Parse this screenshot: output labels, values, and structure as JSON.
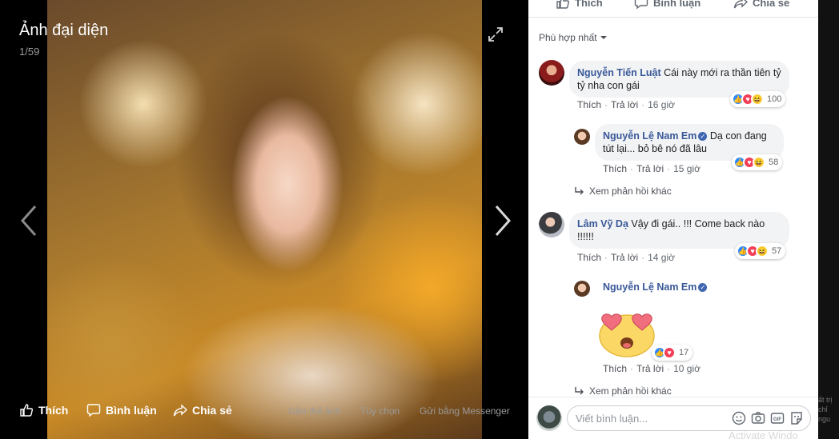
{
  "viewer": {
    "title": "Ảnh đại diện",
    "counter": "1/59",
    "actions": {
      "like": "Thích",
      "comment": "Bình luận",
      "share": "Chia sẻ",
      "tag": "Gắn thẻ ảnh",
      "options": "Tùy chọn",
      "messenger": "Gửi bằng Messenger"
    }
  },
  "panel": {
    "actions": {
      "like": "Thích",
      "comment": "Bình luận",
      "share": "Chia sẻ"
    },
    "sort_label": "Phù hợp nhất",
    "comments": [
      {
        "author": "Nguyễn Tiến Luật",
        "text": "Cái này mới ra thần tiên tỷ tỷ nha con gái",
        "like": "Thích",
        "reply": "Trả lời",
        "time": "16 giờ",
        "reaction_count": "100",
        "replies": [
          {
            "author": "Nguyễn Lệ Nam Em",
            "verified": true,
            "text": "Dạ con đang tút lại... bỏ bê nó đã lâu",
            "like": "Thích",
            "reply": "Trả lời",
            "time": "15 giờ",
            "reaction_count": "58"
          }
        ],
        "more_replies": "Xem phản hồi khác"
      },
      {
        "author": "Lâm Vỹ Dạ",
        "text": "Vậy đi gái.. !!! Come back nào !!!!!!",
        "like": "Thích",
        "reply": "Trả lời",
        "time": "14 giờ",
        "reaction_count": "57",
        "replies": [
          {
            "author": "Nguyễn Lệ Nam Em",
            "verified": true,
            "sticker": "heart-eyes-emoji",
            "like": "Thích",
            "reply": "Trả lời",
            "time": "10 giờ",
            "reaction_count": "17"
          }
        ],
        "more_replies": "Xem phản hồi khác"
      }
    ],
    "composer": {
      "placeholder": "Viết bình luận..."
    }
  },
  "edge": {
    "strip_text": "ất trị chỉ ngu",
    "watermark": "Activate Windo"
  },
  "colors": {
    "link": "#385898",
    "like_blue": "#2e89ff",
    "love_red": "#f33e58",
    "haha_yellow": "#fcd13e"
  }
}
